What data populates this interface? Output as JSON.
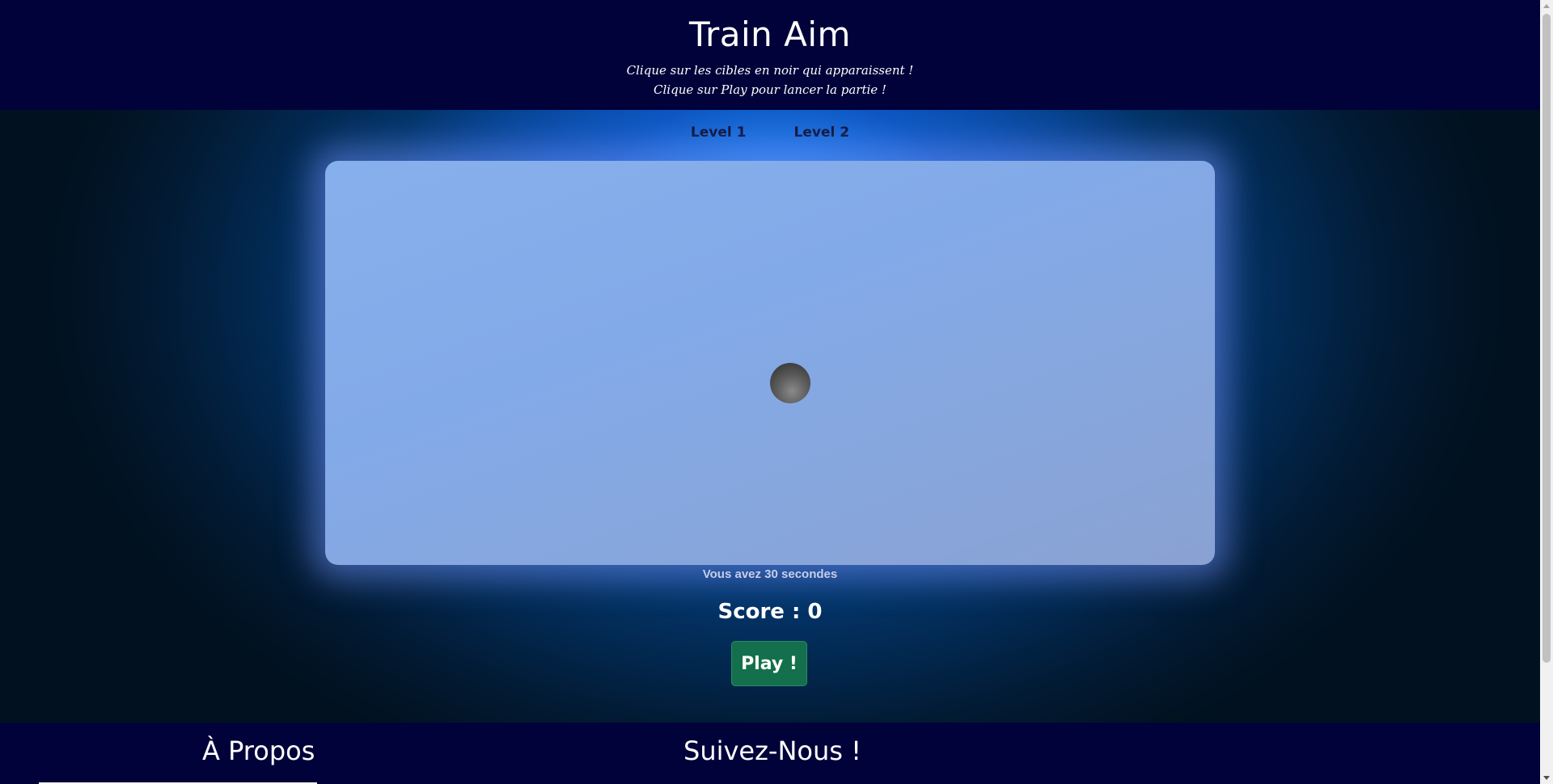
{
  "header": {
    "title": "Train Aim",
    "subtitle_line1": "Clique sur les cibles en noir qui apparaissent !",
    "subtitle_line2": "Clique sur Play pour lancer la partie !"
  },
  "levels": [
    {
      "label": "Level 1"
    },
    {
      "label": "Level 2"
    }
  ],
  "game": {
    "timer_text": "Vous avez 30 secondes",
    "score_text": "Score : 0",
    "play_label": "Play !",
    "target_icon": "target-ball-icon"
  },
  "footer": {
    "about_title": "À Propos",
    "follow_title": "Suivez-Nous !"
  },
  "colors": {
    "header_bg": "#01023a",
    "play_button": "#14704c",
    "game_area": "#83aae8"
  }
}
